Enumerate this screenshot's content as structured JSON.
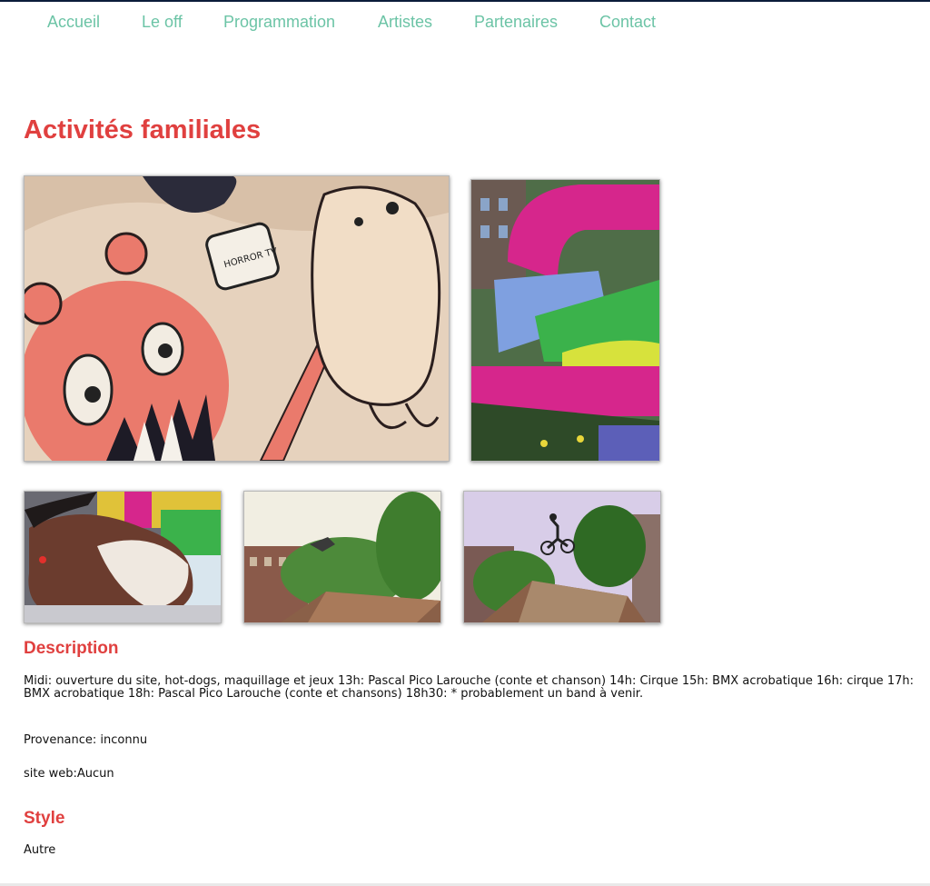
{
  "nav": {
    "items": [
      "Accueil",
      "Le off",
      "Programmation",
      "Artistes",
      "Partenaires",
      "Contact"
    ]
  },
  "page": {
    "title": "Activités familiales"
  },
  "gallery": {
    "images": [
      {
        "subject": "mural-monster-graffiti"
      },
      {
        "subject": "inflatable-bouncy-castle"
      },
      {
        "subject": "mechanical-bull"
      },
      {
        "subject": "bmx-jump-ramp"
      },
      {
        "subject": "bmx-rider-midair"
      }
    ]
  },
  "description": {
    "heading": "Description",
    "body": "Midi: ouverture du site, hot-dogs, maquillage et jeux 13h: Pascal Pico Larouche (conte et chanson) 14h: Cirque 15h: BMX acrobatique 16h: cirque 17h: BMX acrobatique 18h: Pascal Pico Larouche (conte et chansons) 18h30: * probablement un band à venir.",
    "provenance": "Provenance: inconnu",
    "website": "site web:Aucun"
  },
  "style": {
    "heading": "Style",
    "value": "Autre"
  },
  "colors": {
    "nav": "#6cc4a6",
    "heading": "#e0403f"
  }
}
